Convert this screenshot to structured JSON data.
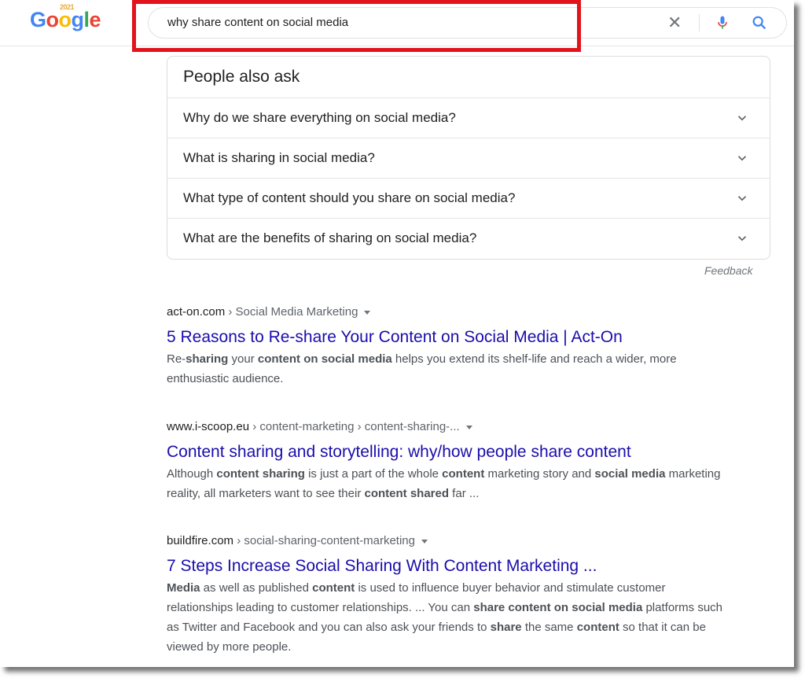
{
  "logo": {
    "year": "2021",
    "letters": [
      "G",
      "o",
      "o",
      "g",
      "l",
      "e"
    ]
  },
  "search": {
    "query": "why share content on social media"
  },
  "paa": {
    "title": "People also ask",
    "questions": [
      "Why do we share everything on social media?",
      "What is sharing in social media?",
      "What type of content should you share on social media?",
      "What are the benefits of sharing on social media?"
    ],
    "feedback": "Feedback"
  },
  "results": [
    {
      "site": "act-on.com",
      "path": " › Social Media Marketing",
      "title": "5 Reasons to Re-share Your Content on Social Media | Act-On",
      "snippet": [
        {
          "t": "Re-",
          "b": false
        },
        {
          "t": "sharing",
          "b": true
        },
        {
          "t": " your ",
          "b": false
        },
        {
          "t": "content on social media",
          "b": true
        },
        {
          "t": " helps you extend its shelf-life and reach a wider, more enthusiastic audience.",
          "b": false
        }
      ]
    },
    {
      "site": "www.i-scoop.eu",
      "path": " › content-marketing › content-sharing-...",
      "title": "Content sharing and storytelling: why/how people share content",
      "snippet": [
        {
          "t": "Although ",
          "b": false
        },
        {
          "t": "content sharing",
          "b": true
        },
        {
          "t": " is just a part of the whole ",
          "b": false
        },
        {
          "t": "content",
          "b": true
        },
        {
          "t": " marketing story and ",
          "b": false
        },
        {
          "t": "social media",
          "b": true
        },
        {
          "t": " marketing reality, all marketers want to see their ",
          "b": false
        },
        {
          "t": "content shared",
          "b": true
        },
        {
          "t": " far ...",
          "b": false
        }
      ]
    },
    {
      "site": "buildfire.com",
      "path": " › social-sharing-content-marketing",
      "title": "7 Steps Increase Social Sharing With Content Marketing ...",
      "snippet": [
        {
          "t": "Media",
          "b": true
        },
        {
          "t": " as well as published ",
          "b": false
        },
        {
          "t": "content",
          "b": true
        },
        {
          "t": " is used to influence buyer behavior and stimulate customer relationships leading to customer relationships. ... You can ",
          "b": false
        },
        {
          "t": "share content on social media",
          "b": true
        },
        {
          "t": " platforms such as Twitter and Facebook and you can also ask your friends to ",
          "b": false
        },
        {
          "t": "share",
          "b": true
        },
        {
          "t": " the same ",
          "b": false
        },
        {
          "t": "content",
          "b": true
        },
        {
          "t": " so that it can be viewed by more people.",
          "b": false
        }
      ]
    }
  ],
  "colors": {
    "link": "#1a0dab",
    "highlight_box": "#e1141b"
  }
}
